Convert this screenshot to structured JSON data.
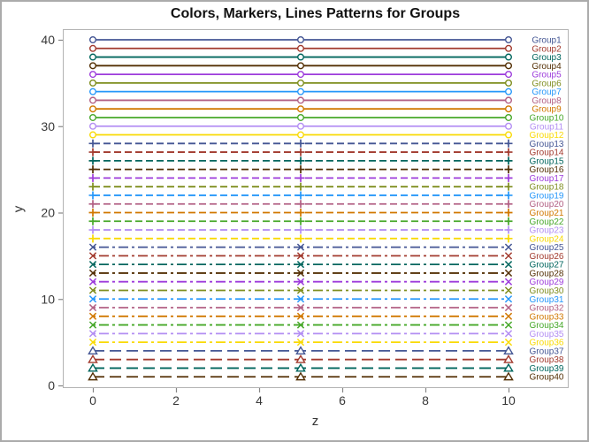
{
  "title": "Colors, Markers, Lines Patterns for Groups",
  "chart_data": {
    "type": "line",
    "title": "Colors, Markers, Lines Patterns for Groups",
    "xlabel": "z",
    "ylabel": "y",
    "x_ticks": [
      0,
      2,
      4,
      6,
      8,
      10
    ],
    "y_ticks": [
      0,
      10,
      20,
      30,
      40
    ],
    "xlim": [
      -0.72,
      11.43
    ],
    "ylim": [
      -0.2,
      41.2
    ],
    "grid": "off",
    "legend_position": "curve-labels-right-inside-plot",
    "marker_x": [
      0,
      5,
      10
    ],
    "x_span": [
      0,
      10
    ],
    "palette": [
      "#445694",
      "#A23A2E",
      "#01665E",
      "#543005",
      "#9D3CDB",
      "#7F8E1F",
      "#2597FA",
      "#B26084",
      "#D17800",
      "#47A82A",
      "#B38EF3",
      "#F9DA04"
    ],
    "series": [
      {
        "name": "Group1",
        "y": 40,
        "color": "#445694",
        "marker": "circle",
        "pattern": "solid"
      },
      {
        "name": "Group2",
        "y": 39,
        "color": "#A23A2E",
        "marker": "circle",
        "pattern": "solid"
      },
      {
        "name": "Group3",
        "y": 38,
        "color": "#01665E",
        "marker": "circle",
        "pattern": "solid"
      },
      {
        "name": "Group4",
        "y": 37,
        "color": "#543005",
        "marker": "circle",
        "pattern": "solid"
      },
      {
        "name": "Group5",
        "y": 36,
        "color": "#9D3CDB",
        "marker": "circle",
        "pattern": "solid"
      },
      {
        "name": "Group6",
        "y": 35,
        "color": "#7F8E1F",
        "marker": "circle",
        "pattern": "solid"
      },
      {
        "name": "Group7",
        "y": 34,
        "color": "#2597FA",
        "marker": "circle",
        "pattern": "solid"
      },
      {
        "name": "Group8",
        "y": 33,
        "color": "#B26084",
        "marker": "circle",
        "pattern": "solid"
      },
      {
        "name": "Group9",
        "y": 32,
        "color": "#D17800",
        "marker": "circle",
        "pattern": "solid"
      },
      {
        "name": "Group10",
        "y": 31,
        "color": "#47A82A",
        "marker": "circle",
        "pattern": "solid"
      },
      {
        "name": "Group11",
        "y": 30,
        "color": "#B38EF3",
        "marker": "circle",
        "pattern": "solid"
      },
      {
        "name": "Group12",
        "y": 29,
        "color": "#F9DA04",
        "marker": "circle",
        "pattern": "solid"
      },
      {
        "name": "Group13",
        "y": 28,
        "color": "#445694",
        "marker": "plus",
        "pattern": "dash"
      },
      {
        "name": "Group14",
        "y": 27,
        "color": "#A23A2E",
        "marker": "plus",
        "pattern": "dash"
      },
      {
        "name": "Group15",
        "y": 26,
        "color": "#01665E",
        "marker": "plus",
        "pattern": "dash"
      },
      {
        "name": "Group16",
        "y": 25,
        "color": "#543005",
        "marker": "plus",
        "pattern": "dash"
      },
      {
        "name": "Group17",
        "y": 24,
        "color": "#9D3CDB",
        "marker": "plus",
        "pattern": "dash"
      },
      {
        "name": "Group18",
        "y": 23,
        "color": "#7F8E1F",
        "marker": "plus",
        "pattern": "dash"
      },
      {
        "name": "Group19",
        "y": 22,
        "color": "#2597FA",
        "marker": "plus",
        "pattern": "dash"
      },
      {
        "name": "Group20",
        "y": 21,
        "color": "#B26084",
        "marker": "plus",
        "pattern": "dash"
      },
      {
        "name": "Group21",
        "y": 20,
        "color": "#D17800",
        "marker": "plus",
        "pattern": "dash"
      },
      {
        "name": "Group22",
        "y": 19,
        "color": "#47A82A",
        "marker": "plus",
        "pattern": "dash"
      },
      {
        "name": "Group23",
        "y": 18,
        "color": "#B38EF3",
        "marker": "plus",
        "pattern": "dash"
      },
      {
        "name": "Group24",
        "y": 17,
        "color": "#F9DA04",
        "marker": "plus",
        "pattern": "dash"
      },
      {
        "name": "Group25",
        "y": 16,
        "color": "#445694",
        "marker": "x",
        "pattern": "dashdot"
      },
      {
        "name": "Group26",
        "y": 15,
        "color": "#A23A2E",
        "marker": "x",
        "pattern": "dashdot"
      },
      {
        "name": "Group27",
        "y": 14,
        "color": "#01665E",
        "marker": "x",
        "pattern": "dashdot"
      },
      {
        "name": "Group28",
        "y": 13,
        "color": "#543005",
        "marker": "x",
        "pattern": "dashdot"
      },
      {
        "name": "Group29",
        "y": 12,
        "color": "#9D3CDB",
        "marker": "x",
        "pattern": "dashdot"
      },
      {
        "name": "Group30",
        "y": 11,
        "color": "#7F8E1F",
        "marker": "x",
        "pattern": "dashdot"
      },
      {
        "name": "Group31",
        "y": 10,
        "color": "#2597FA",
        "marker": "x",
        "pattern": "dashdot"
      },
      {
        "name": "Group32",
        "y": 9,
        "color": "#B26084",
        "marker": "x",
        "pattern": "dashdot"
      },
      {
        "name": "Group33",
        "y": 8,
        "color": "#D17800",
        "marker": "x",
        "pattern": "dashdot"
      },
      {
        "name": "Group34",
        "y": 7,
        "color": "#47A82A",
        "marker": "x",
        "pattern": "dashdot"
      },
      {
        "name": "Group35",
        "y": 6,
        "color": "#B38EF3",
        "marker": "x",
        "pattern": "dashdot"
      },
      {
        "name": "Group36",
        "y": 5,
        "color": "#F9DA04",
        "marker": "x",
        "pattern": "dashdot"
      },
      {
        "name": "Group37",
        "y": 4,
        "color": "#445694",
        "marker": "triangle",
        "pattern": "longdash"
      },
      {
        "name": "Group38",
        "y": 3,
        "color": "#A23A2E",
        "marker": "triangle",
        "pattern": "longdash"
      },
      {
        "name": "Group39",
        "y": 2,
        "color": "#01665E",
        "marker": "triangle",
        "pattern": "longdash"
      },
      {
        "name": "Group40",
        "y": 1,
        "color": "#543005",
        "marker": "triangle",
        "pattern": "longdash"
      }
    ]
  },
  "style": {
    "frame_color": "#b3b3b3",
    "tick_color": "#878787",
    "tick_label_color": "#383838",
    "title_color": "#111111",
    "background": "#ffffff",
    "outer_border": "#ababab"
  }
}
